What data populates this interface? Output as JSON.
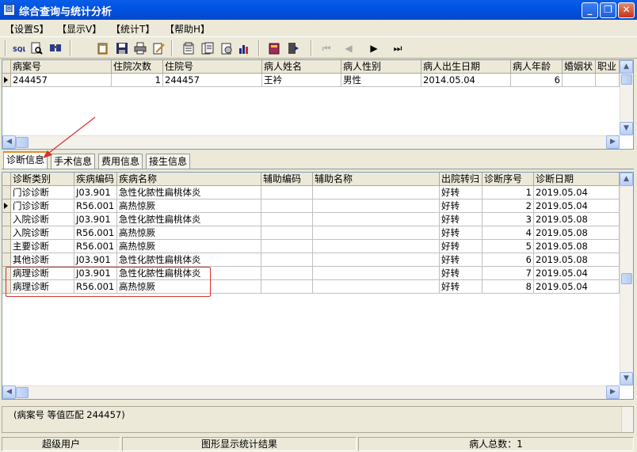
{
  "window": {
    "title": "综合查询与统计分析",
    "app_icon": "回"
  },
  "menu": [
    "【设置S】",
    "【显示V】",
    "【统计T】",
    "【帮助H】"
  ],
  "top_grid": {
    "columns": [
      "病案号",
      "住院次数",
      "住院号",
      "病人姓名",
      "病人性别",
      "病人出生日期",
      "病人年龄",
      "婚姻状",
      "职业"
    ],
    "rows": [
      [
        "244457",
        "1",
        "244457",
        "王衿",
        "男性",
        "2014.05.04",
        "6",
        "",
        ""
      ]
    ]
  },
  "tabs": [
    "诊断信息",
    "手术信息",
    "费用信息",
    "接生信息"
  ],
  "bottom_grid": {
    "columns": [
      "诊断类别",
      "疾病编码",
      "疾病名称",
      "辅助编码",
      "辅助名称",
      "出院转归",
      "诊断序号",
      "诊断日期"
    ],
    "rows": [
      [
        "门诊诊断",
        "J03.901",
        "急性化脓性扁桃体炎",
        "",
        "",
        "好转",
        "1",
        "2019.05.04"
      ],
      [
        "门诊诊断",
        "R56.001",
        "高热惊厥",
        "",
        "",
        "好转",
        "2",
        "2019.05.04"
      ],
      [
        "入院诊断",
        "J03.901",
        "急性化脓性扁桃体炎",
        "",
        "",
        "好转",
        "3",
        "2019.05.08"
      ],
      [
        "入院诊断",
        "R56.001",
        "高热惊厥",
        "",
        "",
        "好转",
        "4",
        "2019.05.08"
      ],
      [
        "主要诊断",
        "R56.001",
        "高热惊厥",
        "",
        "",
        "好转",
        "5",
        "2019.05.08"
      ],
      [
        "其他诊断",
        "J03.901",
        "急性化脓性扁桃体炎",
        "",
        "",
        "好转",
        "6",
        "2019.05.08"
      ],
      [
        "病理诊断",
        "J03.901",
        "急性化脓性扁桃体炎",
        "",
        "",
        "好转",
        "7",
        "2019.05.04"
      ],
      [
        "病理诊断",
        "R56.001",
        "高热惊厥",
        "",
        "",
        "好转",
        "8",
        "2019.05.04"
      ]
    ]
  },
  "filter_text": "(病案号 等值匹配 244457)",
  "status": {
    "user": "超级用户",
    "mode": "图形显示统计结果",
    "total": "病人总数：1"
  },
  "colors": {
    "titlebar": "#0054e3",
    "annotation": "#d9302c",
    "tab_highlight": "#e68b2c"
  }
}
